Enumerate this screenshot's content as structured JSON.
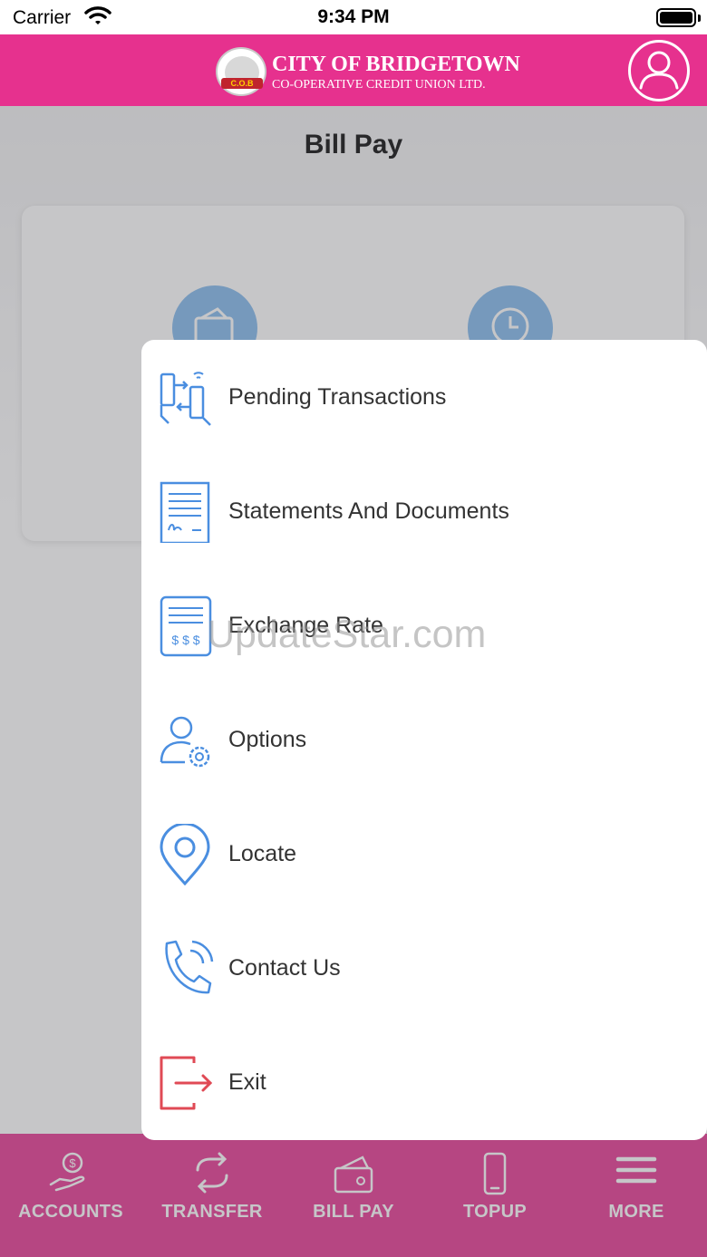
{
  "status_bar": {
    "carrier": "Carrier",
    "time": "9:34 PM"
  },
  "header": {
    "logo_title": "CITY OF BRIDGETOWN",
    "logo_subtitle": "CO-OPERATIVE CREDIT UNION LTD.",
    "logo_badge": "C.O.B"
  },
  "page": {
    "title": "Bill Pay"
  },
  "menu": {
    "items": [
      {
        "label": "Pending Transactions",
        "icon": "pending-transactions-icon"
      },
      {
        "label": "Statements And Documents",
        "icon": "statement-document-icon"
      },
      {
        "label": "Exchange Rate",
        "icon": "exchange-rate-icon"
      },
      {
        "label": "Options",
        "icon": "user-settings-icon"
      },
      {
        "label": "Locate",
        "icon": "location-pin-icon"
      },
      {
        "label": "Contact Us",
        "icon": "phone-call-icon"
      },
      {
        "label": "Exit",
        "icon": "exit-icon"
      }
    ]
  },
  "tabbar": {
    "items": [
      {
        "label": "ACCOUNTS",
        "icon": "hand-money-icon"
      },
      {
        "label": "TRANSFER",
        "icon": "transfer-arrows-icon"
      },
      {
        "label": "BILL PAY",
        "icon": "wallet-card-icon"
      },
      {
        "label": "TOPUP",
        "icon": "mobile-phone-icon"
      },
      {
        "label": "MORE",
        "icon": "hamburger-menu-icon"
      }
    ]
  },
  "watermark": "UpdateStar.com",
  "colors": {
    "brand_pink": "#e6318e",
    "icon_blue": "#4a8ee0",
    "exit_red": "#e04a55",
    "card_icon_blue": "#7eb6ec"
  }
}
